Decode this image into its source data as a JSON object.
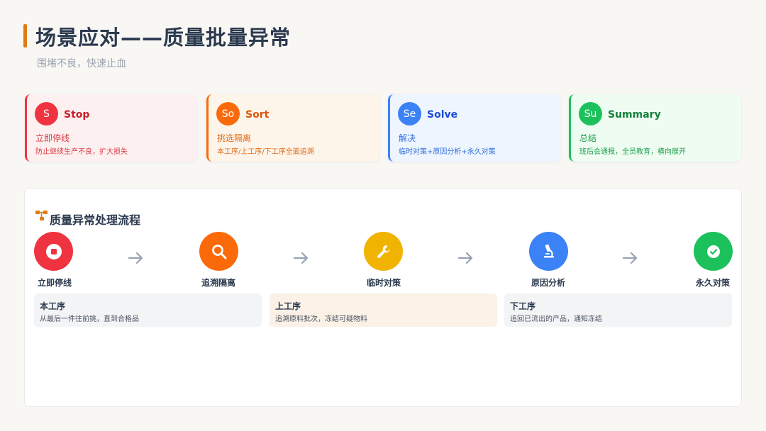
{
  "header": {
    "title": "场景应对——质量批量异常",
    "subtitle": "围堵不良，快速止血"
  },
  "cards": [
    {
      "abbr": "S",
      "title": "Stop",
      "line1": "立即停线",
      "line2": "防止继续生产不良，扩大损失",
      "accent": "#ef3340",
      "bg": "#fdf0f0",
      "titleColor": "#c81e2a",
      "textColor": "#d93a44"
    },
    {
      "abbr": "So",
      "title": "Sort",
      "line1": "挑选隔离",
      "line2": "本工序/上工序/下工序全面追溯",
      "accent": "#fb6a0a",
      "bg": "#fdf4ea",
      "titleColor": "#d95509",
      "textColor": "#e06a17"
    },
    {
      "abbr": "Se",
      "title": "Solve",
      "line1": "解决",
      "line2": "临时对策+原因分析+永久对策",
      "accent": "#3b82f6",
      "bg": "#eef5ff",
      "titleColor": "#1d4ed8",
      "textColor": "#2f6fdc"
    },
    {
      "abbr": "Su",
      "title": "Summary",
      "line1": "总结",
      "line2": "班后会通报，全员教育，横向展开",
      "accent": "#1cc15c",
      "bg": "#effcf2",
      "titleColor": "#15803d",
      "textColor": "#1fa050"
    }
  ],
  "process": {
    "title": "质量异常处理流程",
    "steps": [
      {
        "label": "立即停线",
        "icon": "stop-icon",
        "color": "#ef3340"
      },
      {
        "label": "追溯隔离",
        "icon": "search-icon",
        "color": "#fb6a0a"
      },
      {
        "label": "临时对策",
        "icon": "wrench-icon",
        "color": "#f0b400"
      },
      {
        "label": "原因分析",
        "icon": "microscope-icon",
        "color": "#3b82f6"
      },
      {
        "label": "永久对策",
        "icon": "check-icon",
        "color": "#1cc15c"
      }
    ],
    "info": [
      {
        "title": "本工序",
        "desc": "从最后一件往前挑，直到合格品",
        "bg": "#f3f4f6"
      },
      {
        "title": "上工序",
        "desc": "追溯原料批次，冻结可疑物料",
        "bg": "#fbf1e6"
      },
      {
        "title": "下工序",
        "desc": "追回已流出的产品，通知冻结",
        "bg": "#f3f4f6"
      }
    ]
  }
}
